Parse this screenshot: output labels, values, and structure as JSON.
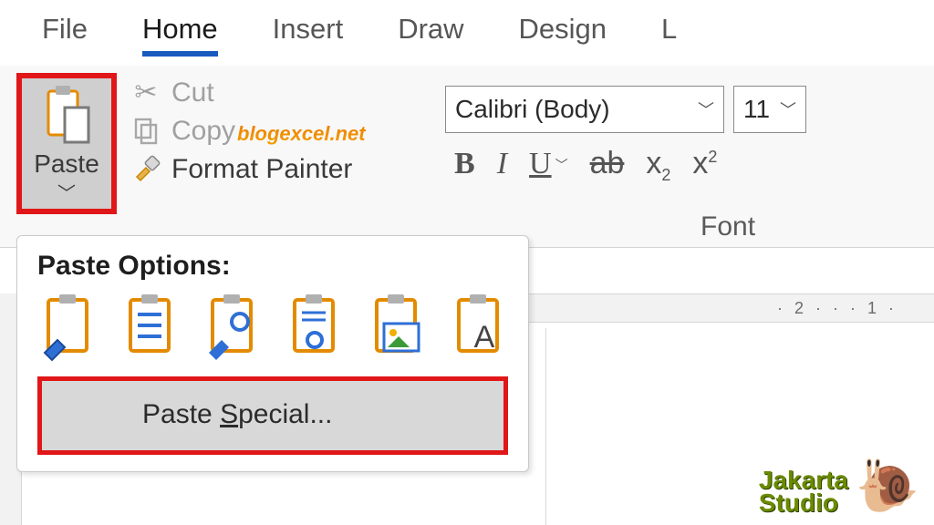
{
  "tabs": {
    "file": "File",
    "home": "Home",
    "insert": "Insert",
    "draw": "Draw",
    "design": "Design",
    "partial": "L"
  },
  "clipboard": {
    "paste_label": "Paste",
    "cut": "Cut",
    "copy": "Copy",
    "format_painter": "Format Painter"
  },
  "font": {
    "family": "Calibri (Body)",
    "size": "11",
    "group_label": "Font",
    "bold": "B",
    "italic": "I",
    "underline": "U",
    "strike": "ab",
    "x": "x",
    "two": "2"
  },
  "dropdown": {
    "title": "Paste Options:",
    "special_pre": "Paste ",
    "special_u": "S",
    "special_post": "pecial..."
  },
  "ruler": {
    "marks": "·  2  ·  ·  ·  1  ·  "
  },
  "watermarks": {
    "blog": "blogexcel.net",
    "jakarta1": "Jakarta",
    "jakarta2": "Studio",
    "snail": "🐌"
  }
}
